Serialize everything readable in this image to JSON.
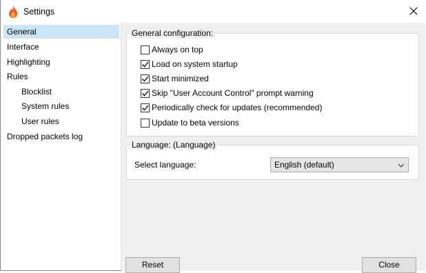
{
  "window": {
    "title": "Settings",
    "icon": "flame-icon",
    "close_icon": "close-icon"
  },
  "sidebar": {
    "items": [
      {
        "label": "General",
        "selected": true
      },
      {
        "label": "Interface"
      },
      {
        "label": "Highlighting"
      },
      {
        "label": "Rules"
      },
      {
        "label": "Blocklist",
        "child": true
      },
      {
        "label": "System rules",
        "child": true
      },
      {
        "label": "User rules",
        "child": true
      },
      {
        "label": "Dropped packets log"
      }
    ]
  },
  "general_group": {
    "title": "General configuration:",
    "options": [
      {
        "label": "Always on top",
        "checked": false
      },
      {
        "label": "Load on system startup",
        "checked": true
      },
      {
        "label": "Start minimized",
        "checked": true
      },
      {
        "label": "Skip \"User Account Control\" prompt warning",
        "checked": true
      },
      {
        "label": "Periodically check for updates (recommended)",
        "checked": true
      },
      {
        "label": "Update to beta versions",
        "checked": false
      }
    ]
  },
  "language_group": {
    "title": "Language: (Language)",
    "select_label": "Select language:",
    "selected_value": "English (default)"
  },
  "buttons": {
    "reset": "Reset",
    "close": "Close"
  },
  "colors": {
    "selection": "#cce4f7",
    "panel_bg": "#f0f0f0",
    "button_bg": "#e1e1e1"
  }
}
